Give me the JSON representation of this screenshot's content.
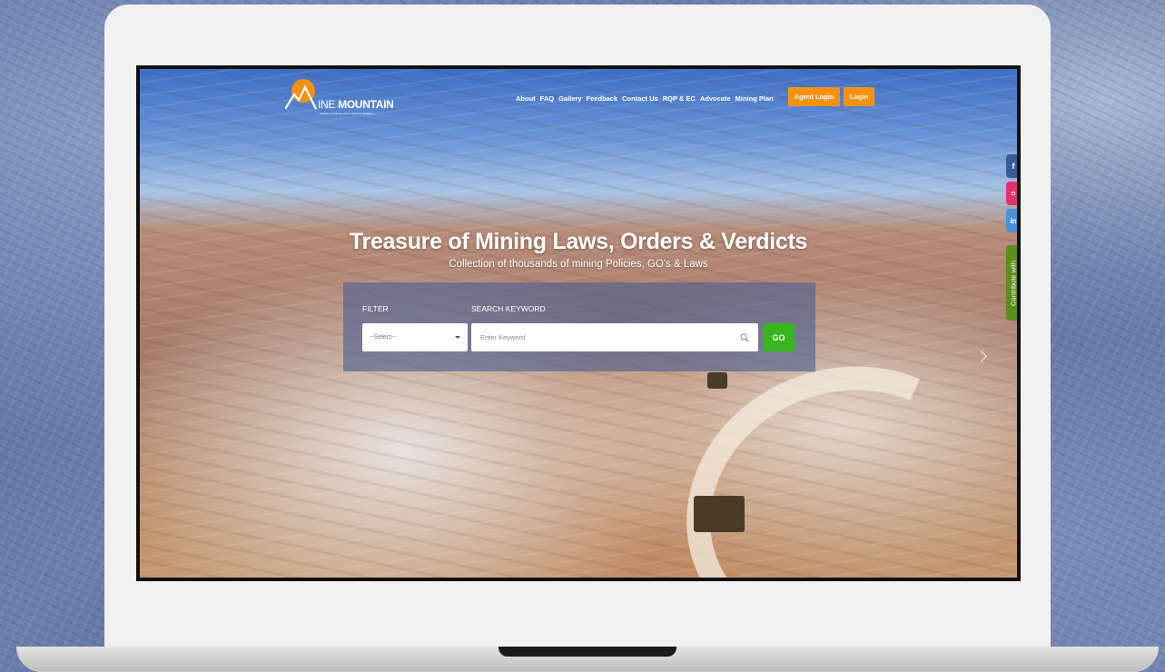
{
  "brand": {
    "prefix": "INE",
    "name": "MOUNTAIN",
    "tagline": "Treasure of Mining Laws, Orders & Solutions",
    "accent_color": "#f39212"
  },
  "nav": {
    "items": [
      "About",
      "FAQ",
      "Gallery",
      "Feedback",
      "Contact Us",
      "RQP & EC",
      "Advocate",
      "Mining Plan"
    ],
    "agent_login": "Agent Login",
    "login": "Login"
  },
  "hero": {
    "title": "Treasure of Mining Laws, Orders & Verdicts",
    "subtitle": "Collection of thousands of mining Policies, GO's & Laws"
  },
  "search": {
    "filter_label": "FILTER",
    "filter_value": "--Select--",
    "keyword_label": "SEARCH KEYWORD",
    "keyword_placeholder": "Enter Keyword",
    "go_label": "GO",
    "go_color": "#37b51f"
  },
  "social": [
    {
      "icon": "facebook-icon",
      "glyph": "f",
      "color": "#3b5998"
    },
    {
      "icon": "instagram-icon",
      "glyph": "◘",
      "color": "#e1306c"
    },
    {
      "icon": "linkedin-icon",
      "glyph": "in",
      "color": "#4a90d9"
    }
  ],
  "contribute": {
    "label": "Contribute with",
    "color": "#5c8e1a"
  },
  "carousel": {
    "next_icon": "chevron-right-icon"
  }
}
